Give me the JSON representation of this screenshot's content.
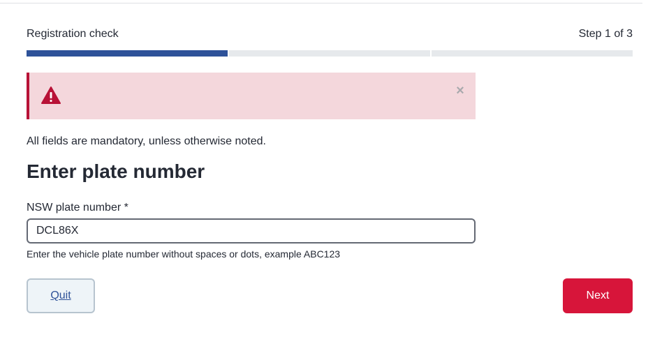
{
  "progress": {
    "title": "Registration check",
    "step_text": "Step 1 of 3",
    "current_step": 1,
    "total_steps": 3,
    "active_color": "#2e5299",
    "inactive_color": "#e6e9ec"
  },
  "alert": {
    "icon": "warning-triangle-icon",
    "close_icon": "close-icon",
    "close_glyph": "×",
    "background_color": "#f4d7dc",
    "accent_color": "#b81237"
  },
  "form": {
    "mandatory_note": "All fields are mandatory, unless otherwise noted.",
    "heading": "Enter plate number",
    "plate_label": "NSW plate number *",
    "plate_value": "DCL86X",
    "plate_help": "Enter the vehicle plate number without spaces or dots, example ABC123"
  },
  "actions": {
    "quit_label": "Quit",
    "next_label": "Next",
    "next_color": "#d7153a"
  }
}
